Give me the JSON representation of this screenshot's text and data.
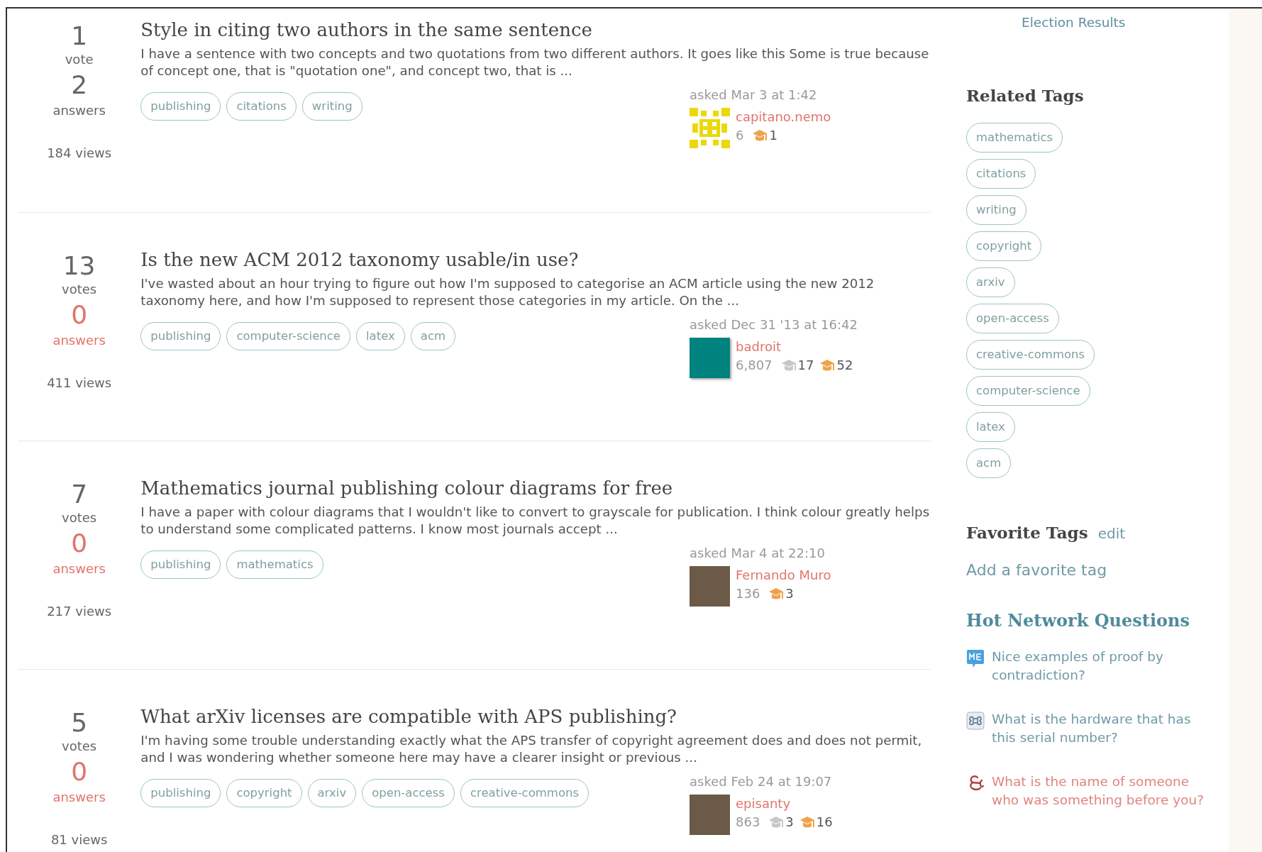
{
  "questions": [
    {
      "votes": "1",
      "votes_label": "vote",
      "answers": "2",
      "answers_label": "answers",
      "answered": true,
      "views": "184 views",
      "title": "Style in citing two authors in the same sentence",
      "excerpt": "I have a sentence with two concepts and two quotations from two different authors. It goes like this Some is true because of concept one, that is \"quotation one\", and concept two, that is ...",
      "tags": [
        "publishing",
        "citations",
        "writing"
      ],
      "asked": "asked Mar 3 at 1:42",
      "user": {
        "name": "capitano.nemo",
        "avatar": {
          "kind": "identicon"
        },
        "reputation": "6",
        "badges": [
          {
            "kind": "bronze",
            "count": "1"
          }
        ]
      }
    },
    {
      "votes": "13",
      "votes_label": "votes",
      "answers": "0",
      "answers_label": "answers",
      "answered": false,
      "views": "411 views",
      "title": "Is the new ACM 2012 taxonomy usable/in use?",
      "excerpt": "I've wasted about an hour trying to figure out how I'm supposed to categorise an ACM article using the new 2012 taxonomy here, and how I'm supposed to represent those categories in my article. On the ...",
      "tags": [
        "publishing",
        "computer-science",
        "latex",
        "acm"
      ],
      "asked": "asked Dec 31 '13 at 16:42",
      "user": {
        "name": "badroit",
        "avatar": {
          "kind": "solid"
        },
        "reputation": "6,807",
        "badges": [
          {
            "kind": "silver",
            "count": "17"
          },
          {
            "kind": "bronze",
            "count": "52"
          }
        ]
      }
    },
    {
      "votes": "7",
      "votes_label": "votes",
      "answers": "0",
      "answers_label": "answers",
      "answered": false,
      "views": "217 views",
      "title": "Mathematics journal publishing colour diagrams for free",
      "excerpt": "I have a paper with colour diagrams that I wouldn't like to convert to grayscale for publication. I think colour greatly helps to understand some complicated patterns. I know most journals accept ...",
      "tags": [
        "publishing",
        "mathematics"
      ],
      "asked": "asked Mar 4 at 22:10",
      "user": {
        "name": "Fernando Muro",
        "avatar": {
          "kind": "photo"
        },
        "reputation": "136",
        "badges": [
          {
            "kind": "bronze",
            "count": "3"
          }
        ]
      }
    },
    {
      "votes": "5",
      "votes_label": "votes",
      "answers": "0",
      "answers_label": "answers",
      "answered": false,
      "views": "81 views",
      "title": "What arXiv licenses are compatible with APS publishing?",
      "excerpt": "I'm having some trouble understanding exactly what the APS transfer of copyright agreement does and does not permit, and I was wondering whether someone here may have a clearer insight or previous ...",
      "tags": [
        "publishing",
        "copyright",
        "arxiv",
        "open-access",
        "creative-commons"
      ],
      "asked": "asked Feb 24 at 19:07",
      "user": {
        "name": "episanty",
        "avatar": {
          "kind": "photo"
        },
        "reputation": "863",
        "badges": [
          {
            "kind": "silver",
            "count": "3"
          },
          {
            "kind": "bronze",
            "count": "16"
          }
        ]
      }
    }
  ],
  "sidebar": {
    "meta_link": "Election Results",
    "related_tags_title": "Related Tags",
    "related_tags": [
      "mathematics",
      "citations",
      "writing",
      "copyright",
      "arxiv",
      "open-access",
      "creative-commons",
      "computer-science",
      "latex",
      "acm"
    ],
    "favorite_tags_title": "Favorite Tags",
    "favorite_tags_edit": "edit",
    "add_favorite": "Add a favorite tag",
    "hot_title": "Hot Network Questions",
    "hot_questions": [
      {
        "kind": "math",
        "text": "Nice examples of proof by contradiction?",
        "visited": false
      },
      {
        "kind": "apple",
        "text": "What is the hardware that has this serial number?",
        "visited": false
      },
      {
        "kind": "english",
        "text": "What is the name of someone who was something before you?",
        "visited": true
      }
    ]
  }
}
